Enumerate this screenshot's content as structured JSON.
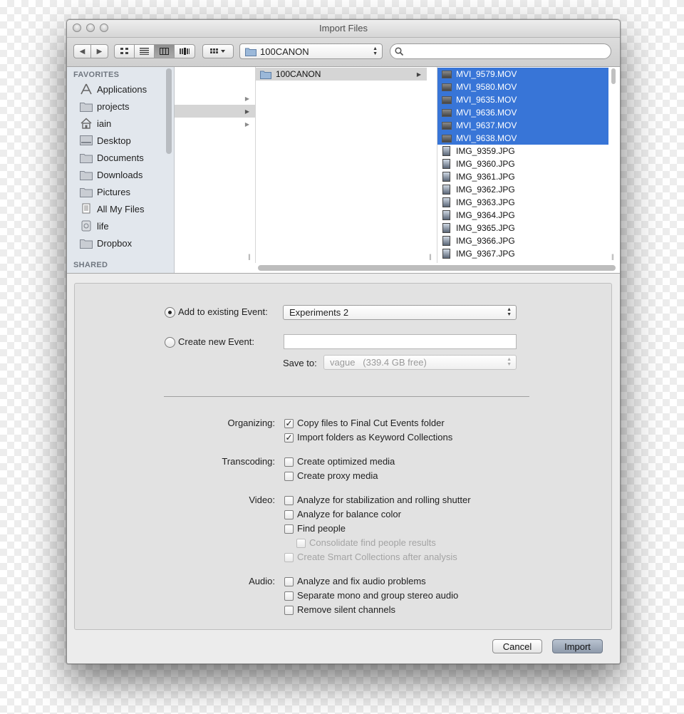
{
  "window": {
    "title": "Import Files"
  },
  "toolbar": {
    "back_label": "◀",
    "forward_label": "▶",
    "path_popup": "100CANON",
    "search_placeholder": ""
  },
  "sidebar": {
    "favorites_heading": "FAVORITES",
    "shared_heading": "SHARED",
    "items": [
      {
        "label": "Applications",
        "icon": "applications-icon"
      },
      {
        "label": "projects",
        "icon": "folder-icon"
      },
      {
        "label": "iain",
        "icon": "home-icon"
      },
      {
        "label": "Desktop",
        "icon": "desktop-icon"
      },
      {
        "label": "Documents",
        "icon": "folder-icon"
      },
      {
        "label": "Downloads",
        "icon": "folder-icon"
      },
      {
        "label": "Pictures",
        "icon": "folder-icon"
      },
      {
        "label": "All My Files",
        "icon": "all-files-icon"
      },
      {
        "label": "life",
        "icon": "drive-icon"
      },
      {
        "label": "Dropbox",
        "icon": "folder-icon"
      }
    ]
  },
  "browser": {
    "folder_column": {
      "selected": "100CANON"
    },
    "files": [
      {
        "name": "MVI_9579.MOV",
        "selected": true
      },
      {
        "name": "MVI_9580.MOV",
        "selected": true
      },
      {
        "name": "MVI_9635.MOV",
        "selected": true
      },
      {
        "name": "MVI_9636.MOV",
        "selected": true
      },
      {
        "name": "MVI_9637.MOV",
        "selected": true
      },
      {
        "name": "MVI_9638.MOV",
        "selected": true
      },
      {
        "name": "IMG_9359.JPG",
        "selected": false
      },
      {
        "name": "IMG_9360.JPG",
        "selected": false
      },
      {
        "name": "IMG_9361.JPG",
        "selected": false
      },
      {
        "name": "IMG_9362.JPG",
        "selected": false
      },
      {
        "name": "IMG_9363.JPG",
        "selected": false
      },
      {
        "name": "IMG_9364.JPG",
        "selected": false
      },
      {
        "name": "IMG_9365.JPG",
        "selected": false
      },
      {
        "name": "IMG_9366.JPG",
        "selected": false
      },
      {
        "name": "IMG_9367.JPG",
        "selected": false
      }
    ]
  },
  "event": {
    "add_existing_label": "Add to existing Event:",
    "add_existing_value": "Experiments 2",
    "create_new_label": "Create new Event:",
    "create_new_value": "",
    "save_to_label": "Save to:",
    "save_to_value": "vague   (339.4 GB free)"
  },
  "options": {
    "organizing": {
      "label": "Organizing:",
      "items": [
        {
          "label": "Copy files to Final Cut Events folder",
          "checked": true
        },
        {
          "label": "Import folders as Keyword Collections",
          "checked": true
        }
      ]
    },
    "transcoding": {
      "label": "Transcoding:",
      "items": [
        {
          "label": "Create optimized media",
          "checked": false
        },
        {
          "label": "Create proxy media",
          "checked": false
        }
      ]
    },
    "video": {
      "label": "Video:",
      "items": [
        {
          "label": "Analyze for stabilization and rolling shutter",
          "checked": false
        },
        {
          "label": "Analyze for balance color",
          "checked": false
        },
        {
          "label": "Find people",
          "checked": false
        },
        {
          "label": "Consolidate find people results",
          "checked": false,
          "disabled": true
        },
        {
          "label": "Create Smart Collections after analysis",
          "checked": false,
          "disabled": true
        }
      ]
    },
    "audio": {
      "label": "Audio:",
      "items": [
        {
          "label": "Analyze and fix audio problems",
          "checked": false
        },
        {
          "label": "Separate mono and group stereo audio",
          "checked": false
        },
        {
          "label": "Remove silent channels",
          "checked": false
        }
      ]
    }
  },
  "buttons": {
    "cancel": "Cancel",
    "import": "Import"
  },
  "colors": {
    "selection": "#3875d7",
    "window": "#ececec",
    "panel": "#e2e2e2"
  }
}
